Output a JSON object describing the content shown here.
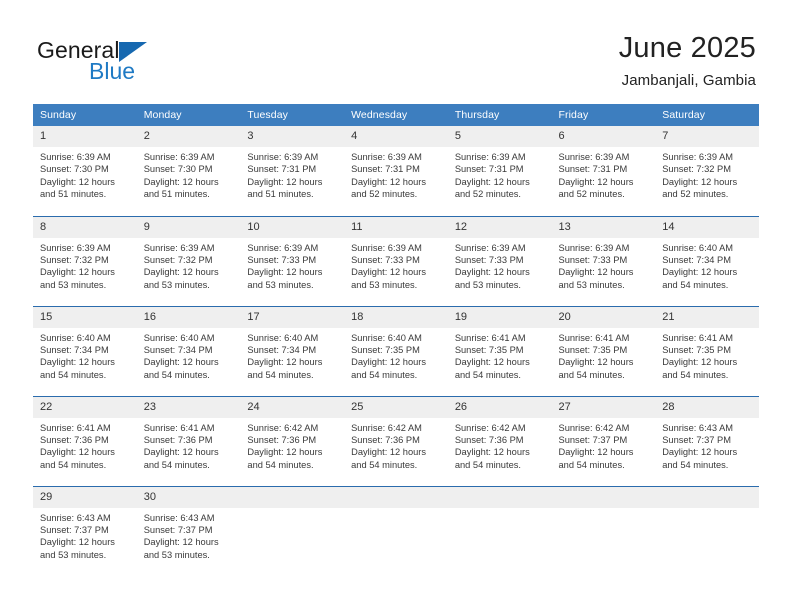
{
  "brand": {
    "name_top": "General",
    "name_bottom": "Blue",
    "triangle_icon": "brand-triangle-icon",
    "color_black": "#1a1a1a",
    "color_blue": "#1f7ac4"
  },
  "header": {
    "title": "June 2025",
    "subtitle": "Jambanjali, Gambia"
  },
  "colors": {
    "header_blue": "#3d7ebf",
    "row_divider_blue": "#2b6cad",
    "daynum_band": "#efefef",
    "text": "#3a3a3a"
  },
  "calendar": {
    "weekday_headers": [
      "Sunday",
      "Monday",
      "Tuesday",
      "Wednesday",
      "Thursday",
      "Friday",
      "Saturday"
    ],
    "weeks": [
      [
        {
          "day": "1",
          "sunrise": "Sunrise: 6:39 AM",
          "sunset": "Sunset: 7:30 PM",
          "daylight_1": "Daylight: 12 hours",
          "daylight_2": "and 51 minutes."
        },
        {
          "day": "2",
          "sunrise": "Sunrise: 6:39 AM",
          "sunset": "Sunset: 7:30 PM",
          "daylight_1": "Daylight: 12 hours",
          "daylight_2": "and 51 minutes."
        },
        {
          "day": "3",
          "sunrise": "Sunrise: 6:39 AM",
          "sunset": "Sunset: 7:31 PM",
          "daylight_1": "Daylight: 12 hours",
          "daylight_2": "and 51 minutes."
        },
        {
          "day": "4",
          "sunrise": "Sunrise: 6:39 AM",
          "sunset": "Sunset: 7:31 PM",
          "daylight_1": "Daylight: 12 hours",
          "daylight_2": "and 52 minutes."
        },
        {
          "day": "5",
          "sunrise": "Sunrise: 6:39 AM",
          "sunset": "Sunset: 7:31 PM",
          "daylight_1": "Daylight: 12 hours",
          "daylight_2": "and 52 minutes."
        },
        {
          "day": "6",
          "sunrise": "Sunrise: 6:39 AM",
          "sunset": "Sunset: 7:31 PM",
          "daylight_1": "Daylight: 12 hours",
          "daylight_2": "and 52 minutes."
        },
        {
          "day": "7",
          "sunrise": "Sunrise: 6:39 AM",
          "sunset": "Sunset: 7:32 PM",
          "daylight_1": "Daylight: 12 hours",
          "daylight_2": "and 52 minutes."
        }
      ],
      [
        {
          "day": "8",
          "sunrise": "Sunrise: 6:39 AM",
          "sunset": "Sunset: 7:32 PM",
          "daylight_1": "Daylight: 12 hours",
          "daylight_2": "and 53 minutes."
        },
        {
          "day": "9",
          "sunrise": "Sunrise: 6:39 AM",
          "sunset": "Sunset: 7:32 PM",
          "daylight_1": "Daylight: 12 hours",
          "daylight_2": "and 53 minutes."
        },
        {
          "day": "10",
          "sunrise": "Sunrise: 6:39 AM",
          "sunset": "Sunset: 7:33 PM",
          "daylight_1": "Daylight: 12 hours",
          "daylight_2": "and 53 minutes."
        },
        {
          "day": "11",
          "sunrise": "Sunrise: 6:39 AM",
          "sunset": "Sunset: 7:33 PM",
          "daylight_1": "Daylight: 12 hours",
          "daylight_2": "and 53 minutes."
        },
        {
          "day": "12",
          "sunrise": "Sunrise: 6:39 AM",
          "sunset": "Sunset: 7:33 PM",
          "daylight_1": "Daylight: 12 hours",
          "daylight_2": "and 53 minutes."
        },
        {
          "day": "13",
          "sunrise": "Sunrise: 6:39 AM",
          "sunset": "Sunset: 7:33 PM",
          "daylight_1": "Daylight: 12 hours",
          "daylight_2": "and 53 minutes."
        },
        {
          "day": "14",
          "sunrise": "Sunrise: 6:40 AM",
          "sunset": "Sunset: 7:34 PM",
          "daylight_1": "Daylight: 12 hours",
          "daylight_2": "and 54 minutes."
        }
      ],
      [
        {
          "day": "15",
          "sunrise": "Sunrise: 6:40 AM",
          "sunset": "Sunset: 7:34 PM",
          "daylight_1": "Daylight: 12 hours",
          "daylight_2": "and 54 minutes."
        },
        {
          "day": "16",
          "sunrise": "Sunrise: 6:40 AM",
          "sunset": "Sunset: 7:34 PM",
          "daylight_1": "Daylight: 12 hours",
          "daylight_2": "and 54 minutes."
        },
        {
          "day": "17",
          "sunrise": "Sunrise: 6:40 AM",
          "sunset": "Sunset: 7:34 PM",
          "daylight_1": "Daylight: 12 hours",
          "daylight_2": "and 54 minutes."
        },
        {
          "day": "18",
          "sunrise": "Sunrise: 6:40 AM",
          "sunset": "Sunset: 7:35 PM",
          "daylight_1": "Daylight: 12 hours",
          "daylight_2": "and 54 minutes."
        },
        {
          "day": "19",
          "sunrise": "Sunrise: 6:41 AM",
          "sunset": "Sunset: 7:35 PM",
          "daylight_1": "Daylight: 12 hours",
          "daylight_2": "and 54 minutes."
        },
        {
          "day": "20",
          "sunrise": "Sunrise: 6:41 AM",
          "sunset": "Sunset: 7:35 PM",
          "daylight_1": "Daylight: 12 hours",
          "daylight_2": "and 54 minutes."
        },
        {
          "day": "21",
          "sunrise": "Sunrise: 6:41 AM",
          "sunset": "Sunset: 7:35 PM",
          "daylight_1": "Daylight: 12 hours",
          "daylight_2": "and 54 minutes."
        }
      ],
      [
        {
          "day": "22",
          "sunrise": "Sunrise: 6:41 AM",
          "sunset": "Sunset: 7:36 PM",
          "daylight_1": "Daylight: 12 hours",
          "daylight_2": "and 54 minutes."
        },
        {
          "day": "23",
          "sunrise": "Sunrise: 6:41 AM",
          "sunset": "Sunset: 7:36 PM",
          "daylight_1": "Daylight: 12 hours",
          "daylight_2": "and 54 minutes."
        },
        {
          "day": "24",
          "sunrise": "Sunrise: 6:42 AM",
          "sunset": "Sunset: 7:36 PM",
          "daylight_1": "Daylight: 12 hours",
          "daylight_2": "and 54 minutes."
        },
        {
          "day": "25",
          "sunrise": "Sunrise: 6:42 AM",
          "sunset": "Sunset: 7:36 PM",
          "daylight_1": "Daylight: 12 hours",
          "daylight_2": "and 54 minutes."
        },
        {
          "day": "26",
          "sunrise": "Sunrise: 6:42 AM",
          "sunset": "Sunset: 7:36 PM",
          "daylight_1": "Daylight: 12 hours",
          "daylight_2": "and 54 minutes."
        },
        {
          "day": "27",
          "sunrise": "Sunrise: 6:42 AM",
          "sunset": "Sunset: 7:37 PM",
          "daylight_1": "Daylight: 12 hours",
          "daylight_2": "and 54 minutes."
        },
        {
          "day": "28",
          "sunrise": "Sunrise: 6:43 AM",
          "sunset": "Sunset: 7:37 PM",
          "daylight_1": "Daylight: 12 hours",
          "daylight_2": "and 54 minutes."
        }
      ],
      [
        {
          "day": "29",
          "sunrise": "Sunrise: 6:43 AM",
          "sunset": "Sunset: 7:37 PM",
          "daylight_1": "Daylight: 12 hours",
          "daylight_2": "and 53 minutes."
        },
        {
          "day": "30",
          "sunrise": "Sunrise: 6:43 AM",
          "sunset": "Sunset: 7:37 PM",
          "daylight_1": "Daylight: 12 hours",
          "daylight_2": "and 53 minutes."
        },
        {
          "day": "",
          "sunrise": "",
          "sunset": "",
          "daylight_1": "",
          "daylight_2": ""
        },
        {
          "day": "",
          "sunrise": "",
          "sunset": "",
          "daylight_1": "",
          "daylight_2": ""
        },
        {
          "day": "",
          "sunrise": "",
          "sunset": "",
          "daylight_1": "",
          "daylight_2": ""
        },
        {
          "day": "",
          "sunrise": "",
          "sunset": "",
          "daylight_1": "",
          "daylight_2": ""
        },
        {
          "day": "",
          "sunrise": "",
          "sunset": "",
          "daylight_1": "",
          "daylight_2": ""
        }
      ]
    ]
  }
}
